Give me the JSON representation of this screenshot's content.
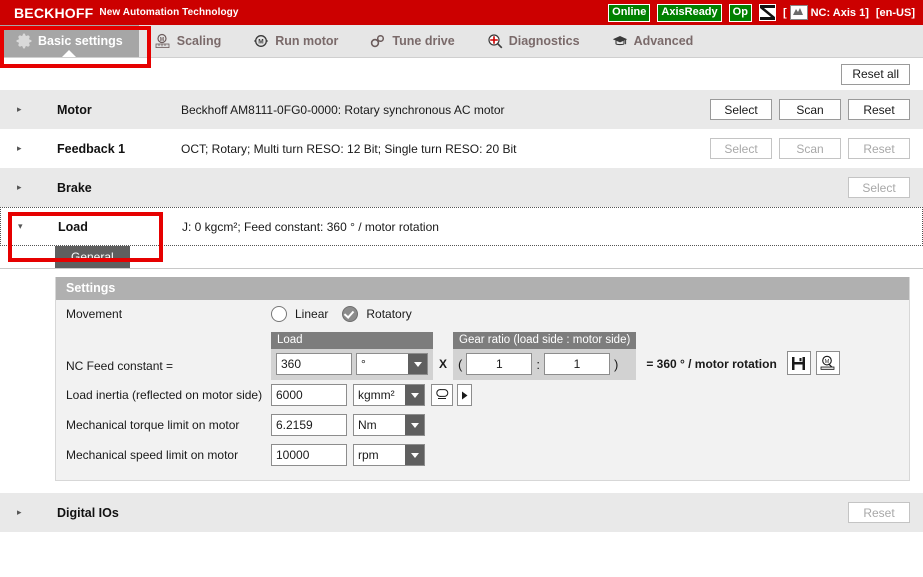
{
  "header": {
    "brand": "BECKHOFF",
    "brand_sub": "New Automation Technology",
    "badges": [
      {
        "label": "Online",
        "color": "#008000"
      },
      {
        "label": "AxisReady",
        "color": "#008000"
      },
      {
        "label": "Op",
        "color": "#008000"
      }
    ],
    "nc_axis_label": "NC: Axis 1]",
    "nc_bracket_open": "[",
    "language": "[en-US]"
  },
  "tabs": [
    {
      "label": "Basic settings",
      "icon": "gear-icon",
      "active": true
    },
    {
      "label": "Scaling",
      "icon": "ruler-magnifier-icon",
      "active": false
    },
    {
      "label": "Run motor",
      "icon": "motor-icon",
      "active": false
    },
    {
      "label": "Tune drive",
      "icon": "gears-icon",
      "active": false
    },
    {
      "label": "Diagnostics",
      "icon": "magnifier-icon",
      "active": false
    },
    {
      "label": "Advanced",
      "icon": "graduation-cap-icon",
      "active": false
    }
  ],
  "toolbar": {
    "reset_all_label": "Reset all"
  },
  "accordion": [
    {
      "title": "Motor",
      "description": "Beckhoff AM8111-0FG0-0000: Rotary synchronous AC motor",
      "arrow": "▸",
      "buttons": [
        {
          "label": "Select",
          "disabled": false
        },
        {
          "label": "Scan",
          "disabled": false
        },
        {
          "label": "Reset",
          "disabled": false
        }
      ]
    },
    {
      "title": "Feedback 1",
      "description": "OCT; Rotary; Multi turn RESO: 12 Bit; Single turn RESO: 20 Bit",
      "arrow": "▸",
      "buttons": [
        {
          "label": "Select",
          "disabled": true
        },
        {
          "label": "Scan",
          "disabled": true
        },
        {
          "label": "Reset",
          "disabled": true
        }
      ]
    },
    {
      "title": "Brake",
      "description": "",
      "arrow": "▸",
      "buttons": [
        {
          "label": "Select",
          "disabled": true
        }
      ]
    },
    {
      "title": "Load",
      "description": "J: 0 kgcm²; Feed constant: 360 ° / motor rotation",
      "arrow": "▾",
      "buttons": []
    }
  ],
  "footer_row": {
    "title": "Digital IOs",
    "arrow": "▸",
    "button": {
      "label": "Reset",
      "disabled": true
    }
  },
  "detail": {
    "subtab_label": "General",
    "panel_title": "Settings",
    "movement": {
      "label": "Movement",
      "option_linear": "Linear",
      "option_rotatory": "Rotatory",
      "selected": "Rotatory"
    },
    "feed_constant": {
      "label": "NC Feed constant =",
      "load_group_header": "Load",
      "load_value": "360",
      "load_unit": "°",
      "multiply_symbol": "X",
      "gear_group_header": "Gear ratio (load side : motor side)",
      "paren_open": "(",
      "gear_load_side": "1",
      "colon": ":",
      "gear_motor_side": "1",
      "paren_close": ")",
      "result": "= 360 ° / motor rotation",
      "save_icon": "save-floppy-icon",
      "detect_icon": "motor-scan-icon"
    },
    "load_inertia": {
      "label": "Load inertia (reflected on motor side)",
      "value": "6000",
      "unit": "kgmm²",
      "shape_icon": "cylinder-icon",
      "play_icon": "play-arrow-icon"
    },
    "torque_limit": {
      "label": "Mechanical torque limit on motor",
      "value": "6.2159",
      "unit": "Nm"
    },
    "speed_limit": {
      "label": "Mechanical speed limit on motor",
      "value": "10000",
      "unit": "rpm"
    }
  },
  "annotations": [
    {
      "name": "basic-settings-highlight"
    },
    {
      "name": "load-row-highlight"
    }
  ]
}
